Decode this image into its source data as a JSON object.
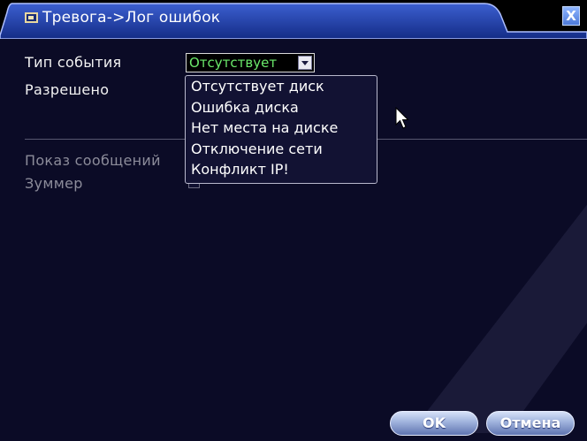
{
  "window": {
    "title": "Тревога->Лог ошибок",
    "close_label": "X"
  },
  "form": {
    "event_type_label": "Тип события",
    "enabled_label": "Разрешено",
    "event_type_value": "Отсутствует",
    "show_messages_label": "Показ сообщений",
    "buzzer_label": "Зуммер"
  },
  "dropdown": {
    "options": [
      "Отсутствует диск",
      "Ошибка диска",
      "Нет места на диске",
      "Отключение сети",
      "Конфликт IP!"
    ]
  },
  "buttons": {
    "ok_label": "OK",
    "cancel_label": "Отмена"
  },
  "colors": {
    "background": "#0b0b26",
    "title_bar": "#203a9c",
    "selected_value": "#6bea6b",
    "disabled_text": "#8c8c9a"
  }
}
